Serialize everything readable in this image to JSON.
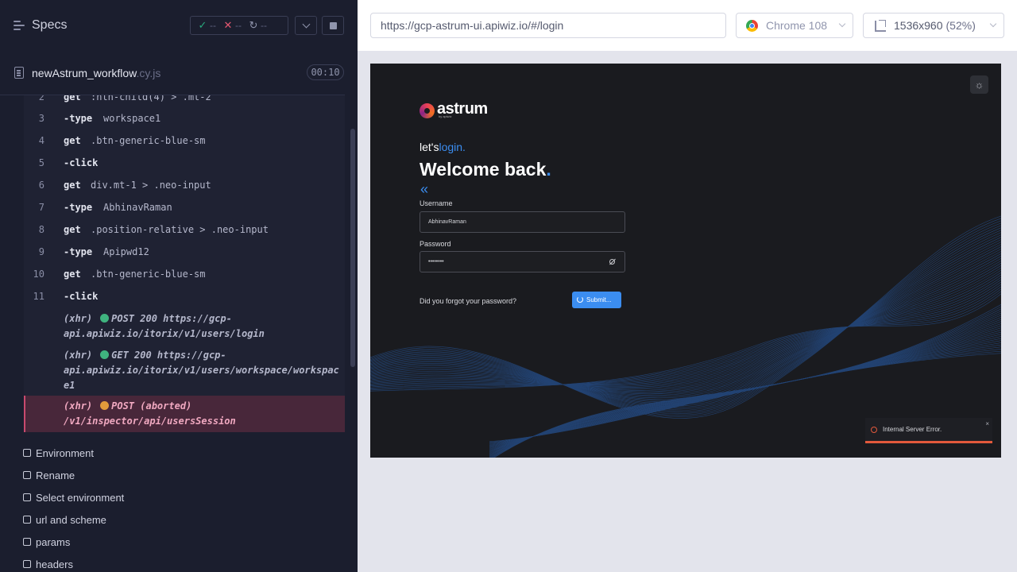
{
  "runner": {
    "title": "Specs",
    "stats": {
      "passed": "--",
      "failed": "--",
      "pending": "--"
    },
    "spec": {
      "name": "newAstrum_workflow",
      "ext": ".cy.js",
      "duration": "00:10"
    },
    "commands": [
      {
        "num": "2",
        "name": "get",
        "arg": ":nth-child(4) > .mt-2"
      },
      {
        "num": "3",
        "name": "-type",
        "arg": "workspace1"
      },
      {
        "num": "4",
        "name": "get",
        "arg": ".btn-generic-blue-sm"
      },
      {
        "num": "5",
        "name": "-click",
        "arg": ""
      },
      {
        "num": "6",
        "name": "get",
        "arg": "div.mt-1 > .neo-input"
      },
      {
        "num": "7",
        "name": "-type",
        "arg": "AbhinavRaman"
      },
      {
        "num": "8",
        "name": "get",
        "arg": ".position-relative > .neo-input"
      },
      {
        "num": "9",
        "name": "-type",
        "arg": "Apipwd12"
      },
      {
        "num": "10",
        "name": "get",
        "arg": ".btn-generic-blue-sm"
      },
      {
        "num": "11",
        "name": "-click",
        "arg": ""
      }
    ],
    "xhr": [
      {
        "tag": "(xhr)",
        "method": "POST 200 https://gcp-",
        "url": "api.apiwiz.io/itorix/v1/users/login",
        "status": "green"
      },
      {
        "tag": "(xhr)",
        "method": "GET 200 https://gcp-",
        "url": "api.apiwiz.io/itorix/v1/users/workspace/workspace1",
        "status": "green"
      },
      {
        "tag": "(xhr)",
        "method": "POST (aborted)",
        "url": "/v1/inspector/api/usersSession",
        "status": "orange"
      }
    ],
    "tests": [
      "Environment",
      "Rename",
      "Select environment",
      "url and scheme",
      "params",
      "headers"
    ]
  },
  "aut": {
    "url": "https://gcp-astrum-ui.apiwiz.io/#/login",
    "browser": "Chrome 108",
    "viewport": "1536x960",
    "viewport_pct": "(52%)"
  },
  "app": {
    "logo": "astrum",
    "logo_sub": "by apiwiz",
    "lets": "let's",
    "login": "login.",
    "welcome": "Welcome back",
    "welcome_dot": ".",
    "back_icon": "«",
    "username_label": "Username",
    "username_value": "AbhinavRaman",
    "password_label": "Password",
    "password_value": "••••••••",
    "forgot": "Did you forgot your password?",
    "submit": "Submit...",
    "toast": "Internal Server Error.",
    "toast_close": "×"
  },
  "colors": {
    "accent": "#3b8df0",
    "error": "#e2593c",
    "pass": "#28a87d",
    "fail": "#e45770"
  }
}
